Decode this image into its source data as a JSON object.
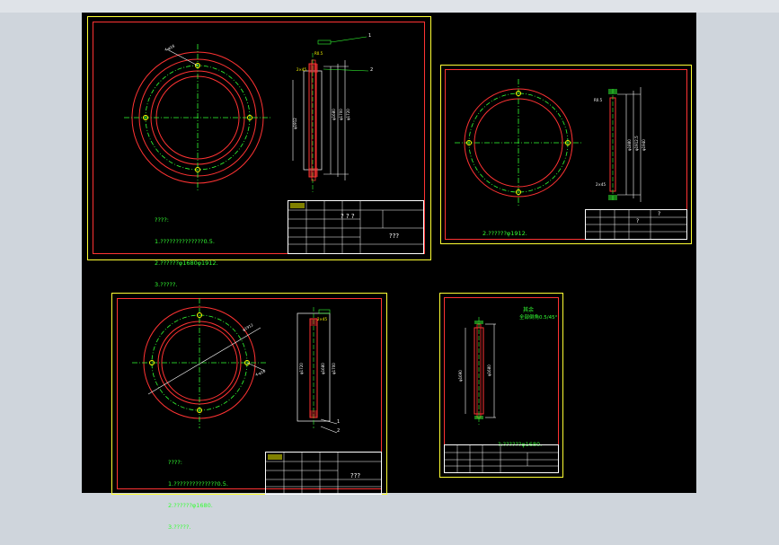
{
  "sheets": [
    {
      "notes": [
        "????:",
        "1.??????????????0.5.",
        "2.??????φ1680φ1912.",
        "3.?????."
      ],
      "title_main": "? ? ?",
      "title_sub": "???",
      "label_callout_1": "1",
      "label_callout_2": "2"
    },
    {
      "notes": [
        "2.??????φ1912."
      ],
      "title_main": "?",
      "title_sub": "?"
    },
    {
      "notes": [
        "????:",
        "1.??????????????0.5.",
        "2.??????φ1680.",
        "3.?????."
      ],
      "title_main": "",
      "title_sub": "???",
      "label_callout_1": "1",
      "label_callout_2": "2"
    },
    {
      "notes": [
        "?:??????φ1680."
      ],
      "header_green_1": "其余",
      "header_green_2": "全部倒角0.5/45°",
      "title_main": "",
      "title_sub": ""
    }
  ],
  "colors": {
    "frame": "#ffff33",
    "border": "#ff3333",
    "center": "#33ff33",
    "dim": "#ffffff",
    "accent": "#ffff00"
  }
}
